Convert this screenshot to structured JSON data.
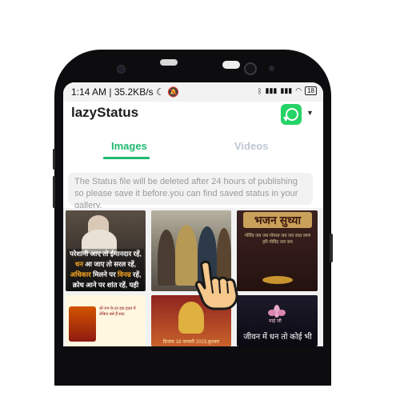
{
  "status_bar": {
    "time": "1:14 AM",
    "speed": "35.2KB/s",
    "battery": "18"
  },
  "app": {
    "title": "lazyStatus"
  },
  "tabs": [
    {
      "label": "Images",
      "active": true
    },
    {
      "label": "Videos",
      "active": false
    }
  ],
  "notice": "The Status file will be deleted after 24 hours of publishing so please save it before.you can find saved status in your gallery.",
  "thumbnails": {
    "t1_caption_parts": [
      "परेशानी आए तो ईमानदार रहें, ",
      "धन",
      " आ जाए तो सरल रहें, ",
      "अधिकार",
      " मिलने पर ",
      "विनम्र",
      " रहें, क्रोध आने पर शांत रहें, यही जीवन का"
    ],
    "t3_title": "भजन सुध्या",
    "t3_lines": "गोविंद जय जय गोपाल जय जय राधा रमण हरि गोविंद जय जय",
    "t4_text": "श्री राम के हर इक हृदय में लेकिन बसे हैं सदा",
    "t5_date": "दिनांक 18 जनवरी 2023,बुधवार",
    "t6_small": "माई जी",
    "t6_text": "जीवन में धन तो कोई भी"
  },
  "colors": {
    "accent": "#1fba70",
    "inactive_tab": "#bfc6d6",
    "whatsapp": "#25d366"
  },
  "icons": [
    "moon-icon",
    "mute-icon",
    "bluetooth-icon",
    "signal-icon",
    "wifi-icon",
    "battery-icon",
    "whatsapp-icon",
    "caret-down-icon",
    "hand-pointer-icon"
  ]
}
